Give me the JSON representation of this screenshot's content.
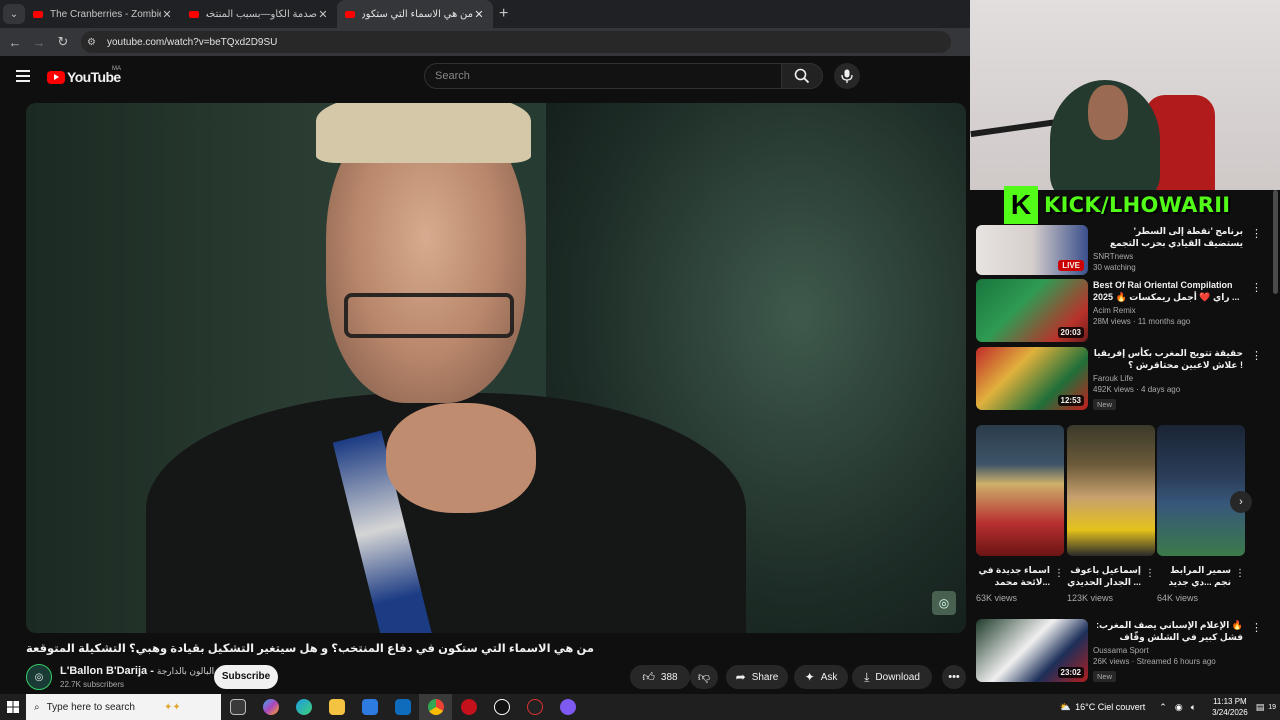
{
  "browser": {
    "tabs": [
      {
        "title": "The Cranberries - Zombie (Alt. Vi..."
      },
      {
        "title": "صدمة الكاو—بسبب المنتخب المغ..."
      },
      {
        "title": "من هي الاسماء التي ستكون في..."
      }
    ],
    "url": "youtube.com/watch?v=beTQxd2D9SU"
  },
  "header": {
    "logo_text": "YouTube",
    "country_code": "MA",
    "search_placeholder": "Search"
  },
  "video": {
    "title": "من هي الاسماء التي ستكون في دفاع المنتخب؟ و هل سيتغير التشكيل بقيادة وهبي؟ التشكيلة المتوقعة",
    "channel_name": "L'Ballon B'Darija -",
    "channel_arabic": "البالون بالدارجة",
    "subscribers": "22.7K subscribers",
    "subscribe_label": "Subscribe",
    "likes": "388",
    "share_label": "Share",
    "ask_label": "Ask",
    "download_label": "Download"
  },
  "overlay": {
    "kick_logo": "K",
    "kick_text": "KICK/LHOWARII"
  },
  "recommendations": [
    {
      "title": "برنامج 'نقطة إلى السطر' يستضيف القيادي بحزب التجمع الوطني للأحرار أنيس بيرو",
      "channel": "SNRTnews",
      "stats": "30 watching",
      "badge": "LIVE",
      "duration": "",
      "is_new": false
    },
    {
      "title": "Best Of Rai Oriental Compilation 2025 🔥 راي ❤️ أجمل ريمكسات ...",
      "channel": "Acim Remix",
      "stats": "28M views · 11 months ago",
      "badge": "",
      "duration": "20:03",
      "is_new": false
    },
    {
      "title": "حقيقة تتويج المغرب بكأس إفريقيا ! علاش لاعبين محتاقرش ؟",
      "channel": "Farouk Life",
      "stats": "492K views · 4 days ago",
      "badge": "",
      "duration": "12:53",
      "is_new": true
    },
    {
      "title": "🔥 الإعلام الإسباني يصف المغرب: فشل كبير في الشلش وقّاف لإبراهيم دياز!",
      "channel": "Oussama Sport",
      "stats": "26K views · Streamed 6 hours ago",
      "badge": "",
      "duration": "23:02",
      "is_new": true
    }
  ],
  "rec_new_label": "New",
  "shorts": [
    {
      "title": "اسماء جديدة في ...لائحة محمد وهبي",
      "views": "63K views"
    },
    {
      "title": "إسماعيل باعوف ... الجدار الحديدي",
      "views": "123K views"
    },
    {
      "title": "سمير المرابط نجم ...دي جديد يطرق",
      "views": "64K views"
    }
  ],
  "taskbar": {
    "search_placeholder": "Type here to search",
    "weather": "16°C  Ciel couvert",
    "time": "11:13 PM",
    "date": "3/24/2026",
    "notification_count": "19"
  },
  "colors": {
    "background": "#0f0f0f",
    "accent_red": "#ff0000",
    "kick_green": "#53fc18"
  }
}
